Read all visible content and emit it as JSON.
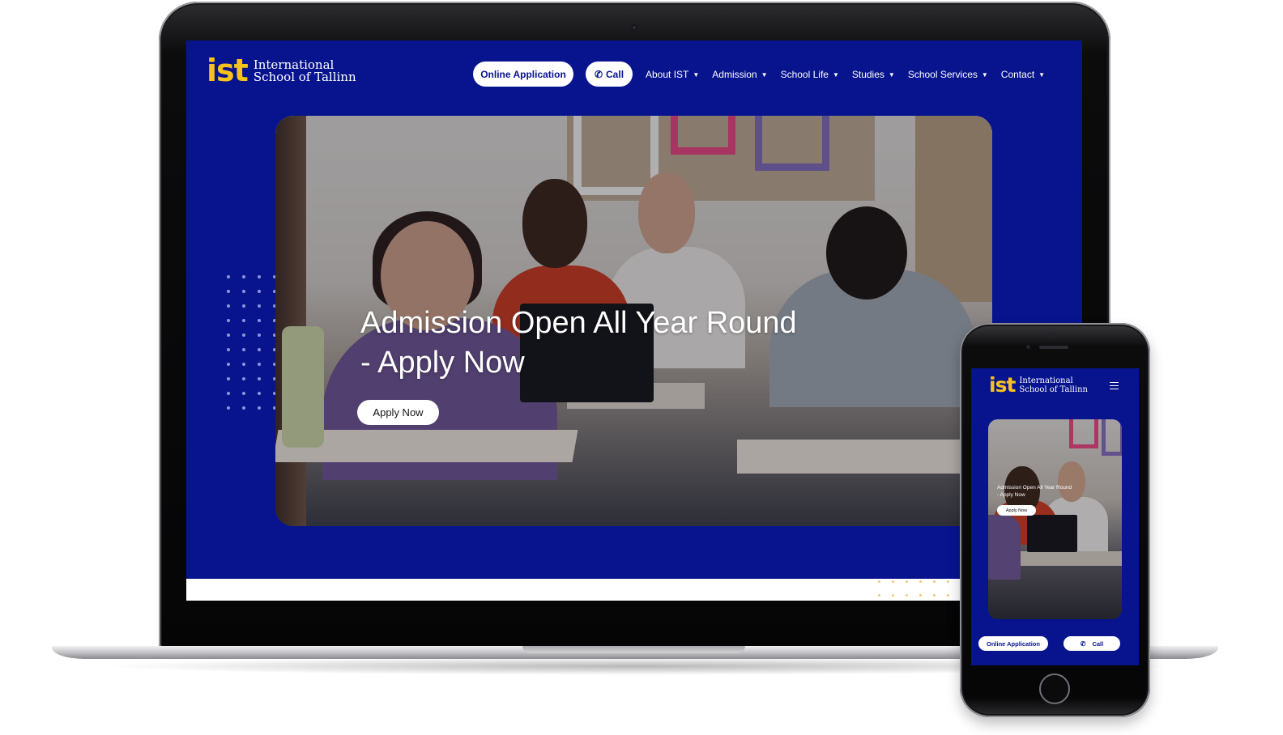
{
  "brand": {
    "logo_mark": "ist",
    "name_line1": "International",
    "name_line2": "School of Tallinn",
    "colors": {
      "primary": "#07148e",
      "accent": "#f7c21a",
      "pill_bg": "#ffffff"
    }
  },
  "desktop": {
    "nav": {
      "online_application": "Online Application",
      "call": "Call",
      "items": [
        {
          "label": "About IST",
          "icon": "chevron-down-icon"
        },
        {
          "label": "Admission",
          "icon": "chevron-down-icon"
        },
        {
          "label": "School Life",
          "icon": "chevron-down-icon"
        },
        {
          "label": "Studies",
          "icon": "chevron-down-icon"
        },
        {
          "label": "School Services",
          "icon": "chevron-down-icon"
        },
        {
          "label": "Contact",
          "icon": "chevron-down-icon"
        }
      ]
    },
    "hero": {
      "title_line1": "Admission Open All Year Round",
      "title_line2": "- Apply Now",
      "button": "Apply Now"
    }
  },
  "mobile": {
    "menu_icon": "hamburger-menu-icon",
    "hero": {
      "title_line1": "Admission Open All Year Round",
      "title_line2": "- Apply Now",
      "button": "Apply Now"
    },
    "online_application": "Online Application",
    "call": "Call"
  },
  "icons": {
    "phone": "phone-icon",
    "chevron": "chevron-down-icon"
  }
}
